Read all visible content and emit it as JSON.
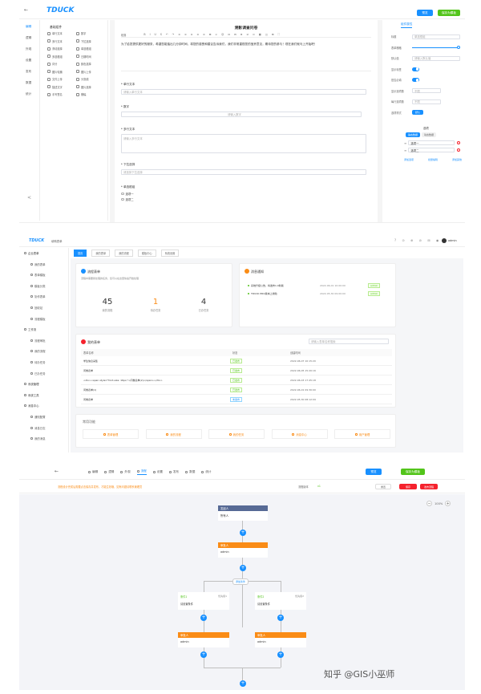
{
  "top": {
    "back_glyph": "←",
    "logo": "TDUCK",
    "btn_preview": "预览",
    "btn_save": "保存为模板",
    "nav": [
      "编辑",
      "逻辑",
      "外观",
      "设置",
      "发布",
      "数据",
      "统计"
    ],
    "controls_title": "基础组件",
    "controls": [
      "单行文本",
      "数字",
      "多行文本",
      "下拉选择",
      "滑动选择",
      "单选框组",
      "多选框组",
      "日期时间",
      "评分",
      "颜色选择",
      "图片轮播",
      "图片上传",
      "文件上传",
      "分割线",
      "描述文字",
      "图片选择",
      "手写签名",
      "横幅"
    ],
    "form_title": "溯影调查问卷",
    "toolbar": "段落",
    "description": "为了给您提供更好的服务，希望您能抽出几分钟时间，将您的感受和建议告诉我们，我们非常重视您的宝贵意见，期待您的参与！现在我们就马上开始吧！",
    "questions": [
      {
        "label": "* 单行文本",
        "placeholder": "请输入单行文本"
      },
      {
        "label": "* 数字",
        "placeholder": "请输入数字"
      },
      {
        "label": "* 多行文本",
        "placeholder": "请输入多行文本"
      },
      {
        "label": "* 下拉选择",
        "placeholder": "请选择下拉选择"
      },
      {
        "label": "* 单选框组",
        "options": [
          "选项一",
          "选项二"
        ]
      }
    ],
    "props_tab": "组件属性",
    "props": [
      {
        "label": "标题",
        "value": "单选框组"
      },
      {
        "label": "表单栅格",
        "value": ""
      },
      {
        "label": "默认值",
        "value": "请输入默认值"
      },
      {
        "label": "显示标签",
        "value": ""
      },
      {
        "label": "是否必填",
        "value": ""
      },
      {
        "label": "显示选项数",
        "value": "不限"
      },
      {
        "label": "每行选项数",
        "value": "不限"
      },
      {
        "label": "选项样式",
        "value": "默认"
      }
    ],
    "options_title": "选项",
    "option_tabs": [
      "静态数据",
      "动态数据"
    ],
    "option_items": [
      "选项一",
      "选项二"
    ],
    "option_links": [
      "添加选项",
      "批量编辑",
      "添加其他"
    ]
  },
  "middle": {
    "logo": "TDUCK",
    "logo_sub": "填鸭表单",
    "tabs": [
      "首页",
      "我的表单",
      "我的流程",
      "模板中心",
      "系统设置"
    ],
    "user": "admin",
    "sidebar": [
      "企业表单",
      "我的表单",
      "表单模板",
      "模板分类",
      "协作表单",
      "回收站",
      "流程模板",
      "工作流",
      "流程审批",
      "我的流程",
      "待办任务",
      "已办任务",
      "系统管理",
      "系统工具",
      "消息中心",
      "通知配置",
      "消息日志",
      "我的消息"
    ],
    "flow_card": {
      "title": "流程表单",
      "subtitle": "流程中需要我处理的任务，您可以在这里快速开始处理",
      "stats": [
        {
          "num": "45",
          "label": "我的流程"
        },
        {
          "num": "1",
          "label": "待办任务"
        },
        {
          "num": "4",
          "label": "已办任务"
        }
      ]
    },
    "notice_card": {
      "title": "消息通知",
      "items": [
        {
          "text": "系统升级公告，将发布1.0新版",
          "date": "2022-06-01 10:00:00",
          "tag": "admin"
        },
        {
          "text": "TDUCK PRO版本上线啦",
          "date": "2022-05-30 09:00:00",
          "tag": "admin"
        }
      ]
    },
    "recent_card": {
      "title": "我的表单",
      "search": "请输入表单名称搜索",
      "headers": [
        "表单名称",
        "状态",
        "创建时间"
      ],
      "rows": [
        {
          "name": "学生信息采集",
          "status": "已发布",
          "time": "2022-06-07 10:15:20"
        },
        {
          "name": "问卷表单",
          "status": "已发布",
          "time": "2022-06-05 15:20:16"
        },
        {
          "name": "<div><span style=\"font-size: 16px;\">问卷表单(2)</span></div>",
          "status": "已发布",
          "time": "2022-06-03 17:45:18"
        },
        {
          "name": "问卷表单(1)",
          "status": "已发布",
          "time": "2022-06-01 09:30:00"
        },
        {
          "name": "问卷表单",
          "status": "未发布",
          "time": "2022-05-30 08:12:09"
        }
      ]
    },
    "quick_title": "常用功能",
    "quick": [
      "表单管理",
      "我的流程",
      "我的任务",
      "消息中心",
      "用户管理"
    ]
  },
  "bottom": {
    "tabs": [
      "编辑",
      "逻辑",
      "外观",
      "流程",
      "设置",
      "发布",
      "数据",
      "统计"
    ],
    "btn_preview": "预览",
    "btn_save": "保存为模板",
    "warning": "流程设计完成后需要点击保存并发布，才能生效哦，如有问题请联系管理员",
    "version_label": "流程版本",
    "version": "v1",
    "btn_save_flow": "保存",
    "btn_publish": "发布流程",
    "btn_reset": "重置",
    "zoom": "100%",
    "nodes": {
      "start": {
        "title": "发起人",
        "body": "所有人"
      },
      "approve": {
        "title": "审批人",
        "body": "admin"
      },
      "branch": "添加条件",
      "cond1": {
        "title": "条件1",
        "body": "请设置条件",
        "priority": "优先级1"
      },
      "cond2": {
        "title": "条件2",
        "body": "请设置条件",
        "priority": "优先级2"
      },
      "app1": {
        "title": "审批人",
        "body": "admin"
      },
      "app2": {
        "title": "审批人",
        "body": "admin"
      }
    },
    "watermark": "知乎 @GIS小巫师"
  }
}
